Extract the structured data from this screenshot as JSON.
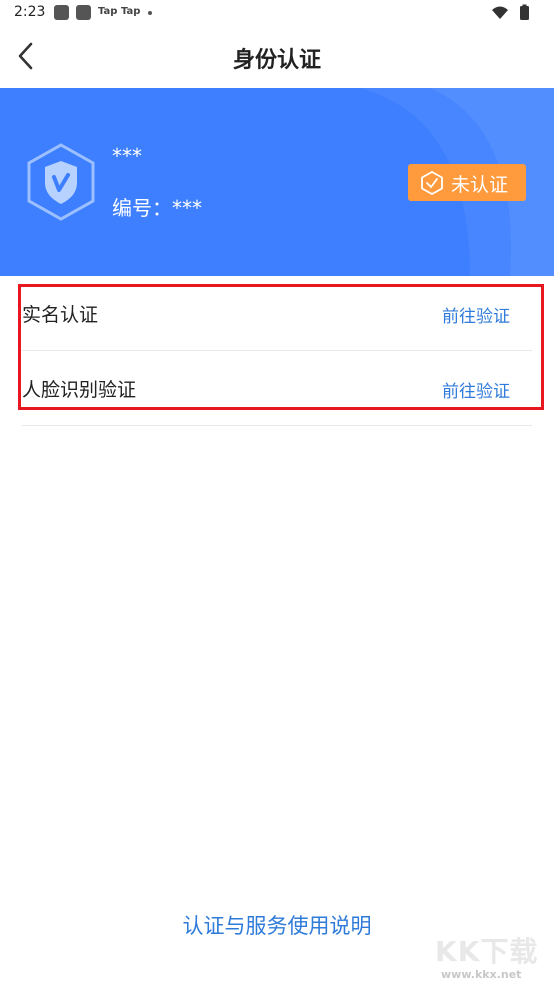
{
  "status_bar": {
    "time": "2:23",
    "app_label_1": "Tap",
    "app_label_2": "Tap",
    "icons": [
      "wifi-icon",
      "battery-icon"
    ]
  },
  "header": {
    "title": "身份认证",
    "back_icon": "chevron-left-icon"
  },
  "profile": {
    "name": "***",
    "id_label": "编号：",
    "id_value": "***",
    "shield_icon": "shield-v-icon",
    "status_label": "未认证",
    "status_icon": "hexagon-check-icon",
    "banner_color": "#3d7fff",
    "badge_color": "#ff9a3d"
  },
  "verifications": [
    {
      "label": "实名认证",
      "action": "前往验证"
    },
    {
      "label": "人脸识别验证",
      "action": "前往验证"
    }
  ],
  "footer": {
    "link": "认证与服务使用说明",
    "link_color": "#2f7bd9"
  },
  "watermark": {
    "logo": "KK下载",
    "url": "www.kkx.net"
  }
}
